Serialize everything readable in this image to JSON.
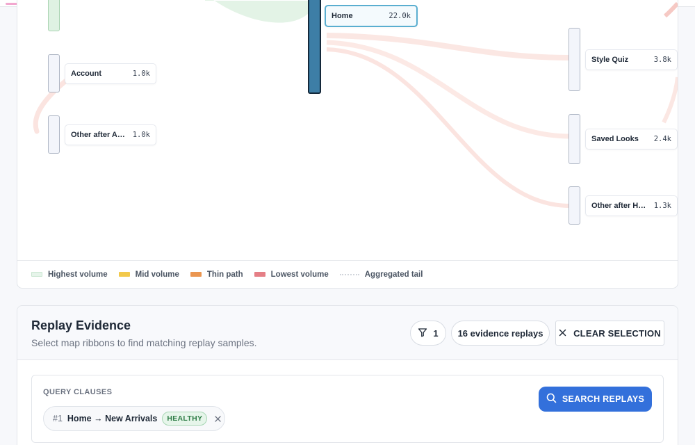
{
  "map": {
    "nodes": {
      "account": {
        "name": "Account",
        "value": "1.0k"
      },
      "other_account": {
        "name": "Other after Account",
        "value": "1.0k"
      },
      "home": {
        "name": "Home",
        "value": "22.0k"
      },
      "style_quiz": {
        "name": "Style Quiz",
        "value": "3.8k"
      },
      "saved_looks": {
        "name": "Saved Looks",
        "value": "2.4k"
      },
      "other_home": {
        "name": "Other after Home",
        "value": "1.3k"
      }
    },
    "legend": [
      {
        "label": "Highest volume",
        "color": "#e6f4ea"
      },
      {
        "label": "Mid volume",
        "color": "#f2c94c"
      },
      {
        "label": "Thin path",
        "color": "#eb9650"
      },
      {
        "label": "Lowest volume",
        "color": "#e57f86"
      },
      {
        "label": "Aggregated tail",
        "color": "#d1d5db"
      }
    ],
    "colors": {
      "selected_node": "#3d7ea6",
      "ribbon_green": "#e3f3e6",
      "ribbon_pink": "#fbe7e3"
    }
  },
  "replay": {
    "title": "Replay Evidence",
    "subtitle": "Select map ribbons to find matching replay samples.",
    "filter_count": "1",
    "evidence_label": "16 evidence replays",
    "clear_label": "CLEAR SELECTION",
    "query": {
      "heading": "QUERY CLAUSES",
      "search_label": "SEARCH REPLAYS",
      "clauses": [
        {
          "index": "#1",
          "text": "Home → New Arrivals",
          "status": "HEALTHY"
        }
      ]
    }
  },
  "icons": {
    "filter": "filter-icon",
    "close": "close-icon",
    "search": "search-icon"
  }
}
